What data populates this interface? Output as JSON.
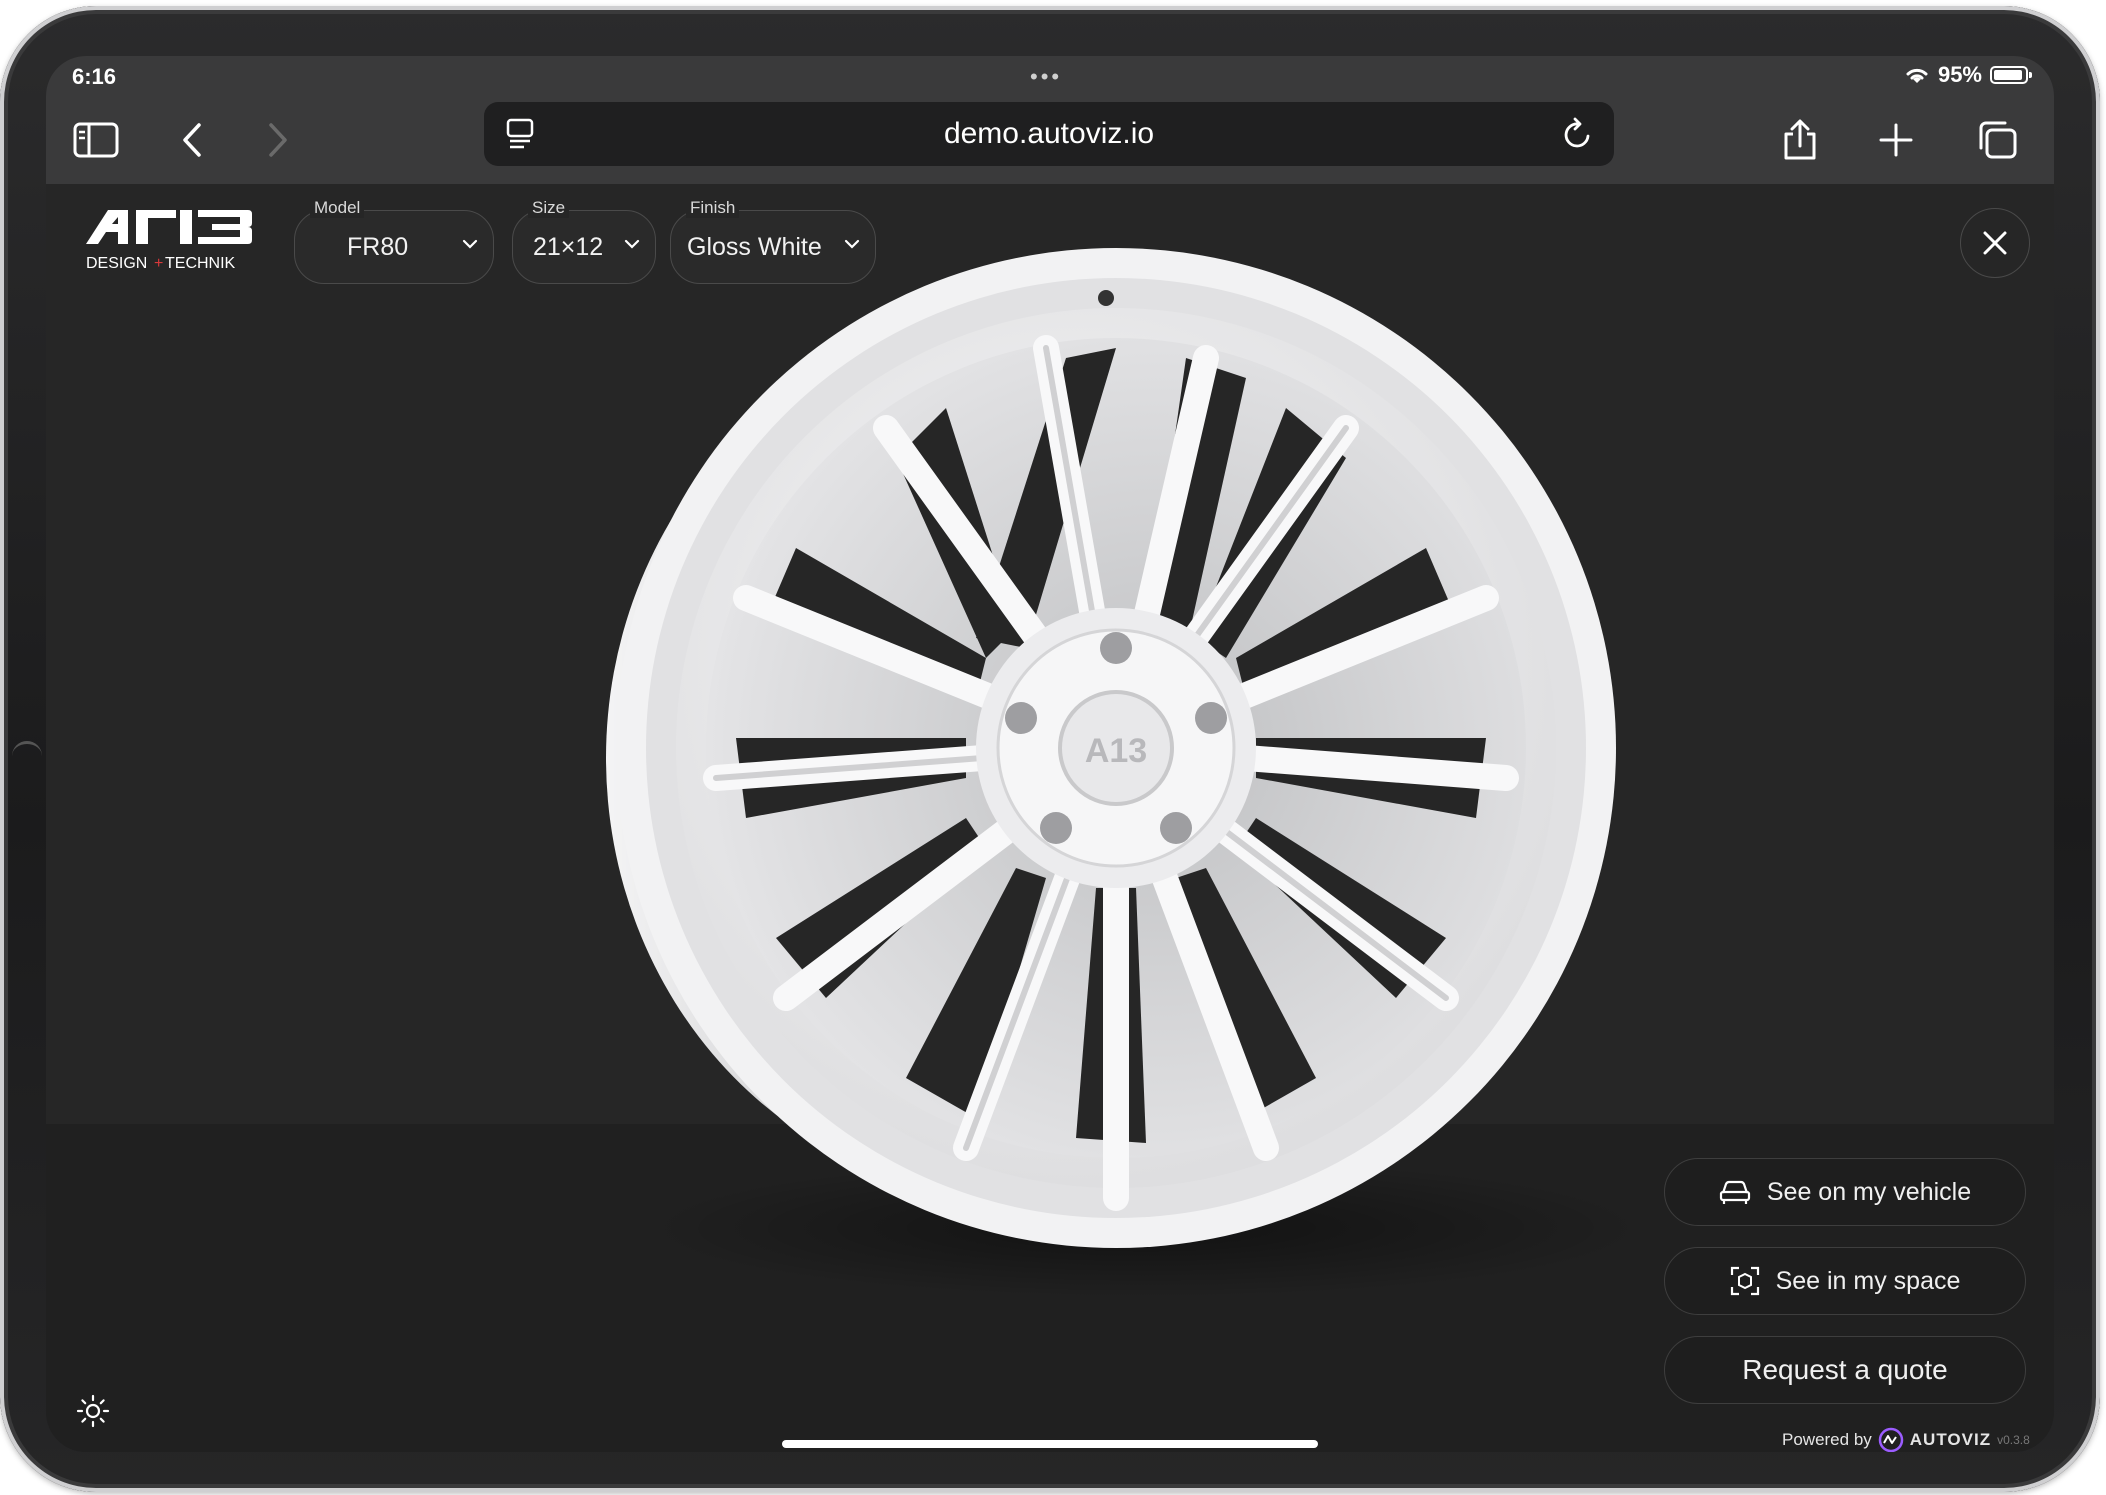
{
  "status_bar": {
    "time": "6:16",
    "battery": "95%",
    "dots": "•••"
  },
  "browser": {
    "url": "demo.autoviz.io"
  },
  "logo": {
    "brand": "A13",
    "tagline_left": "DESIGN",
    "tagline_right": "TECHNIK"
  },
  "selectors": [
    {
      "label": "Model",
      "value": "FR80"
    },
    {
      "label": "Size",
      "value": "21×12"
    },
    {
      "label": "Finish",
      "value": "Gloss White"
    }
  ],
  "actions": {
    "vehicle": "See on my vehicle",
    "space": "See in my space",
    "quote": "Request a quote"
  },
  "footer": {
    "powered_by": "Powered by",
    "brand": "AUTOVIZ",
    "version": "v0.3.8"
  },
  "colors": {
    "background": "#262626",
    "chrome": "#3a3a3b",
    "accent": "#9b5cff",
    "wheel": "#e9e9ea"
  }
}
